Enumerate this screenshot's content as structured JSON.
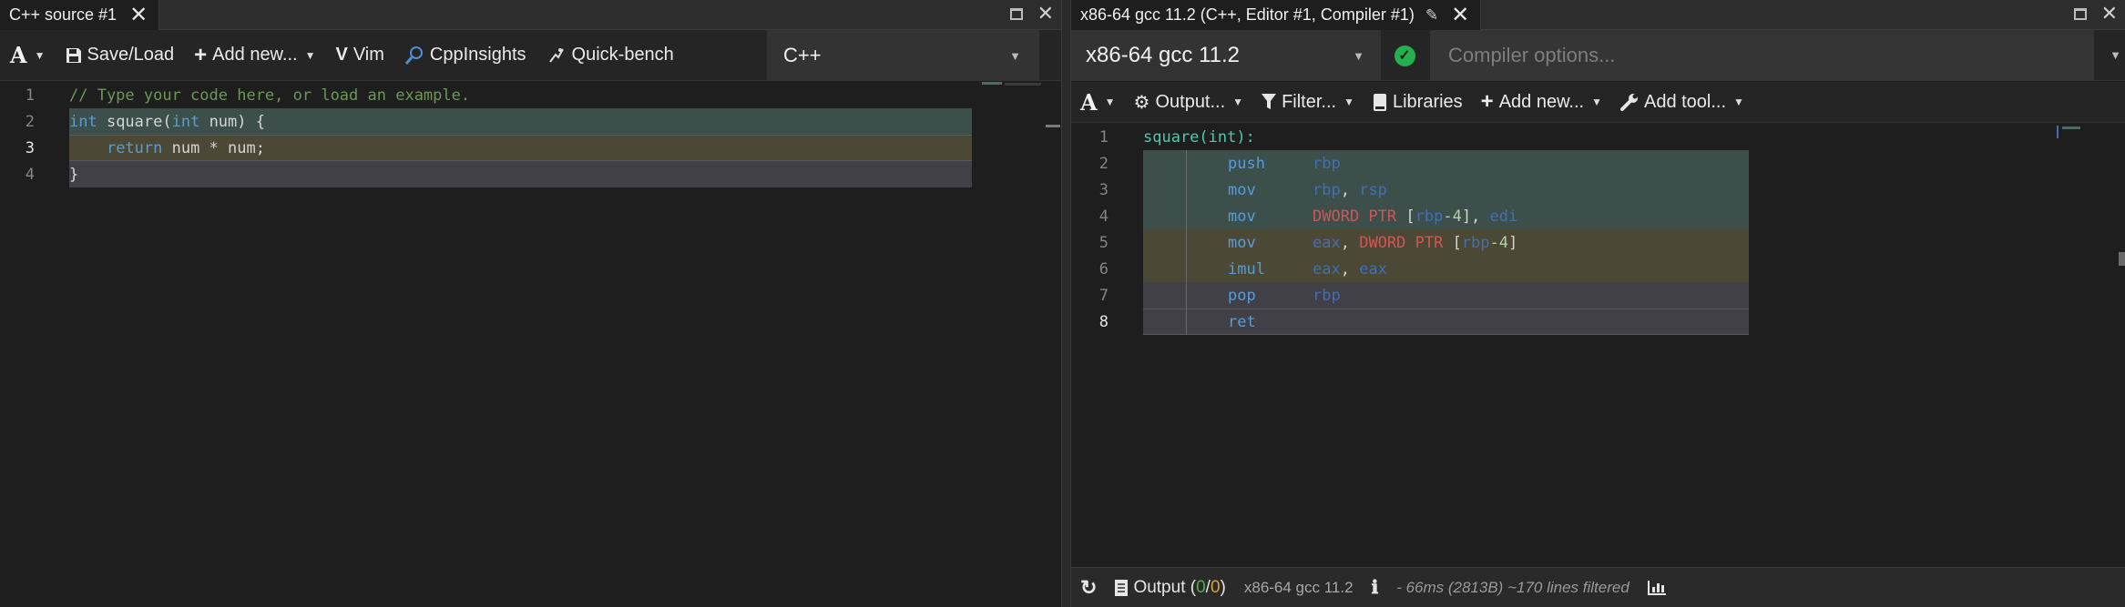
{
  "left": {
    "tab_title": "C++ source #1",
    "toolbar": {
      "font_label": "A",
      "save_load": "Save/Load",
      "add_new": "Add new...",
      "vim": "Vim",
      "cppinsights": "CppInsights",
      "quick_bench": "Quick-bench"
    },
    "language": "C++",
    "lines": [
      {
        "n": "1",
        "tokens": [
          {
            "t": "// Type your code here, or load an example.",
            "c": "c-comment"
          }
        ]
      },
      {
        "n": "2",
        "tokens": [
          {
            "t": "int",
            "c": "c-kw"
          },
          {
            "t": " square(",
            "c": "c-id"
          },
          {
            "t": "int",
            "c": "c-kw"
          },
          {
            "t": " num) {",
            "c": "c-id"
          }
        ]
      },
      {
        "n": "3",
        "tokens": [
          {
            "t": "    ",
            "c": "c-id"
          },
          {
            "t": "return",
            "c": "c-kw"
          },
          {
            "t": " num * num;",
            "c": "c-id"
          }
        ]
      },
      {
        "n": "4",
        "tokens": [
          {
            "t": "}",
            "c": "c-id"
          }
        ]
      }
    ],
    "highlight_colors": [
      "#3d4f4b",
      "#4b4935",
      "#424047"
    ]
  },
  "right": {
    "tab_title": "x86-64 gcc 11.2 (C++, Editor #1, Compiler #1)",
    "compiler": "x86-64 gcc 11.2",
    "options_placeholder": "Compiler options...",
    "toolbar": {
      "font_label": "A",
      "output": "Output...",
      "filter": "Filter...",
      "libraries": "Libraries",
      "add_new": "Add new...",
      "add_tool": "Add tool..."
    },
    "lines": [
      {
        "n": "1",
        "label": "square(int):",
        "mn": "",
        "ops": []
      },
      {
        "n": "2",
        "label": "",
        "mn": "push",
        "ops": [
          {
            "t": "rbp",
            "c": "c-reg"
          }
        ]
      },
      {
        "n": "3",
        "label": "",
        "mn": "mov",
        "ops": [
          {
            "t": "rbp",
            "c": "c-reg"
          },
          {
            "t": ", ",
            "c": "c-id"
          },
          {
            "t": "rsp",
            "c": "c-reg"
          }
        ]
      },
      {
        "n": "4",
        "label": "",
        "mn": "mov",
        "ops": [
          {
            "t": "DWORD PTR ",
            "c": "c-asmkw"
          },
          {
            "t": "[",
            "c": "c-id"
          },
          {
            "t": "rbp",
            "c": "c-reg"
          },
          {
            "t": "-4",
            "c": "c-num"
          },
          {
            "t": "], ",
            "c": "c-id"
          },
          {
            "t": "edi",
            "c": "c-reg"
          }
        ]
      },
      {
        "n": "5",
        "label": "",
        "mn": "mov",
        "ops": [
          {
            "t": "eax",
            "c": "c-reg"
          },
          {
            "t": ", ",
            "c": "c-id"
          },
          {
            "t": "DWORD PTR ",
            "c": "c-asmkw"
          },
          {
            "t": "[",
            "c": "c-id"
          },
          {
            "t": "rbp",
            "c": "c-reg"
          },
          {
            "t": "-4",
            "c": "c-num"
          },
          {
            "t": "]",
            "c": "c-id"
          }
        ]
      },
      {
        "n": "6",
        "label": "",
        "mn": "imul",
        "ops": [
          {
            "t": "eax",
            "c": "c-reg"
          },
          {
            "t": ", ",
            "c": "c-id"
          },
          {
            "t": "eax",
            "c": "c-reg"
          }
        ]
      },
      {
        "n": "7",
        "label": "",
        "mn": "pop",
        "ops": [
          {
            "t": "rbp",
            "c": "c-reg"
          }
        ]
      },
      {
        "n": "8",
        "label": "",
        "mn": "ret",
        "ops": []
      }
    ],
    "status": {
      "output_label": "Output (",
      "ok_count": "0",
      "sep": "/",
      "err_count": "0",
      "close_paren": ")",
      "compiler": "x86-64 gcc 11.2",
      "info": "- 66ms (2813B) ~170 lines filtered"
    }
  }
}
